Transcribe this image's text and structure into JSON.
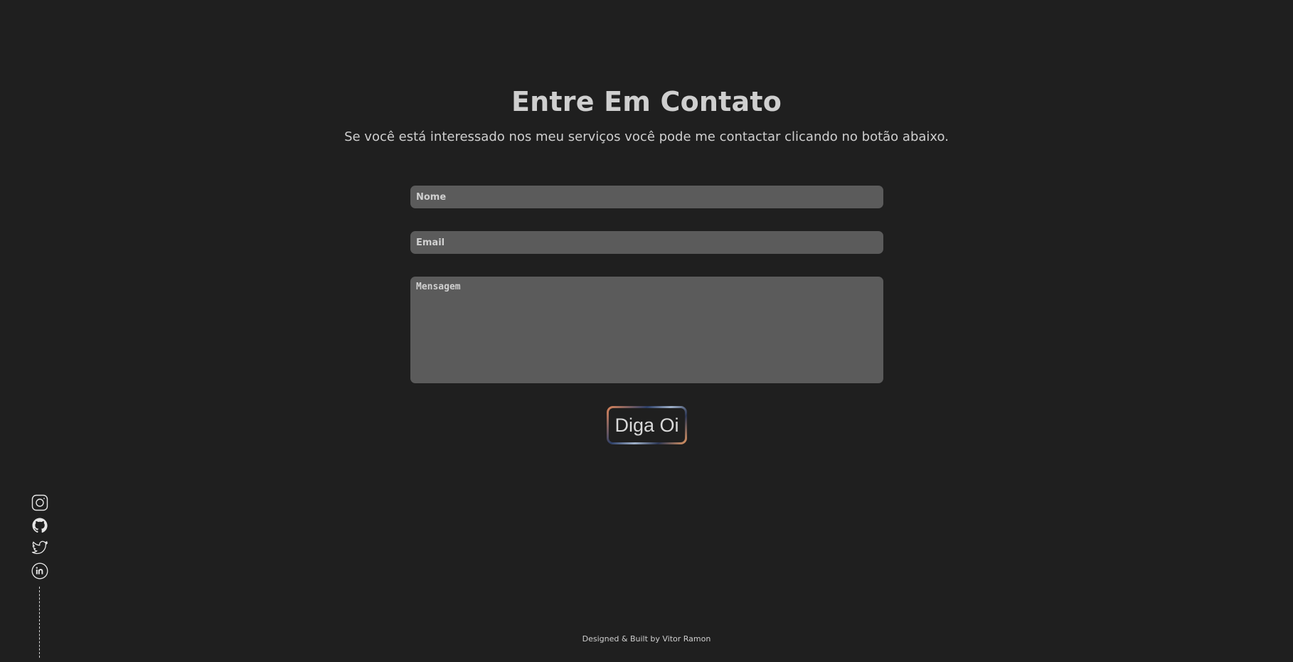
{
  "contact": {
    "title": "Entre Em Contato",
    "subtitle": "Se você está interessado nos meu serviços você pode me contactar clicando no botão abaixo."
  },
  "form": {
    "name_placeholder": "Nome",
    "email_placeholder": "Email",
    "message_placeholder": "Mensagem",
    "name_value": "",
    "email_value": "",
    "message_value": "",
    "submit_label": "Diga Oi"
  },
  "social": {
    "icons": [
      "instagram-icon",
      "github-icon",
      "twitter-icon",
      "linkedin-icon"
    ]
  },
  "footer": {
    "credit": "Designed & Built by Vitor Ramon"
  },
  "colors": {
    "background": "#1f1f1f",
    "field_background": "#5b5b5b",
    "text": "#cfcfcf",
    "button_gradient_warm": "#e0875a",
    "button_gradient_cool": "#2c3e66"
  }
}
